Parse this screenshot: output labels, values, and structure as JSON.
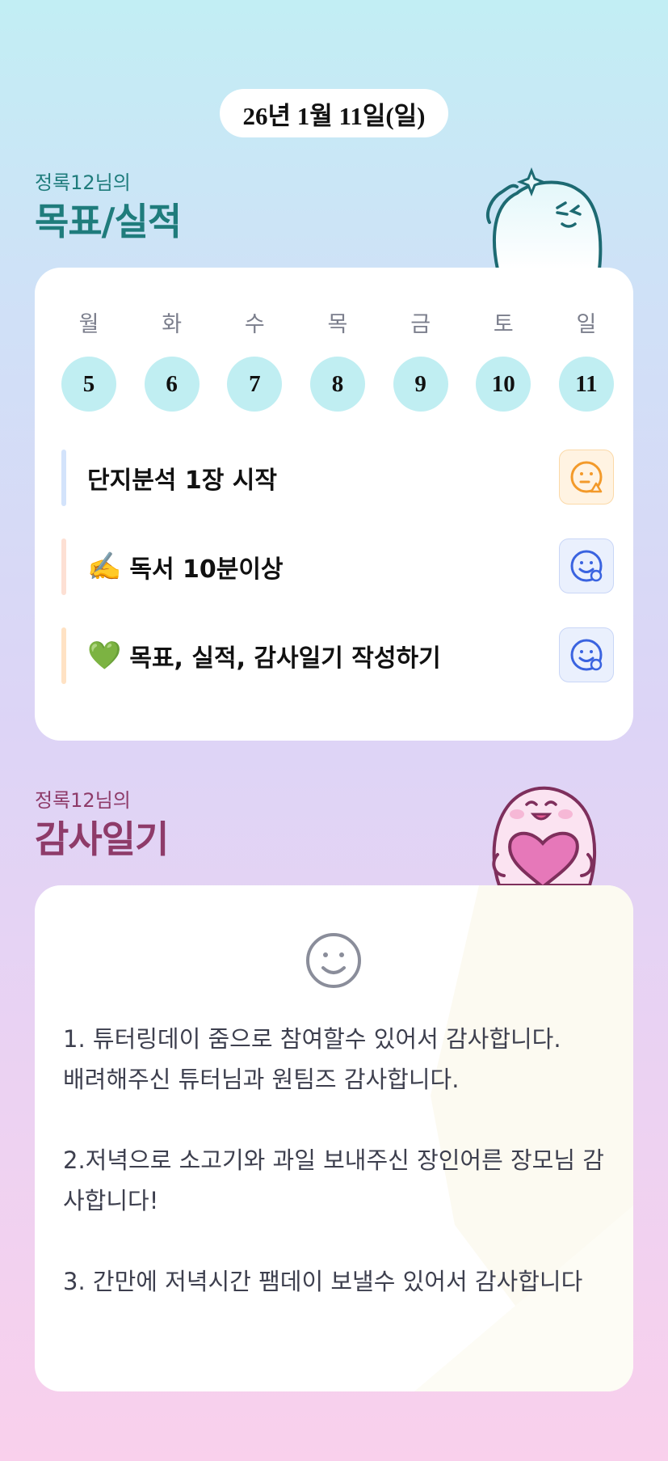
{
  "date": "26년 1월 11일(일)",
  "goals_section": {
    "subtitle": "정록12님의",
    "title": "목표/실적",
    "weekdays": [
      "월",
      "화",
      "수",
      "목",
      "금",
      "토",
      "일"
    ],
    "days": [
      "5",
      "6",
      "7",
      "8",
      "9",
      "10",
      "11"
    ],
    "goals": [
      {
        "emoji": "",
        "text": "단지분석 1장 시작",
        "bar_color": "#d3e3fb",
        "status_icon": "face-triangle-icon",
        "status_color": "#f39a2a",
        "status_bg": "#fff3e2"
      },
      {
        "emoji": "✍️",
        "text": "독서 10분이상",
        "bar_color": "#fde0d4",
        "status_icon": "face-circle-icon",
        "status_color": "#3a63e0",
        "status_bg": "#eaf0fd"
      },
      {
        "emoji": "💚",
        "text": "목표, 실적, 감사일기 작성하기",
        "bar_color": "#ffe2c4",
        "status_icon": "face-circle-icon",
        "status_color": "#3a63e0",
        "status_bg": "#eaf0fd"
      }
    ]
  },
  "diary_section": {
    "subtitle": "정록12님의",
    "title": "감사일기",
    "mood_icon": "smiley-face-icon",
    "text": "1. 튜터링데이 줌으로 참여할수 있어서 감사합니다.\n배려해주신 튜터님과 원팀즈 감사합니다.\n\n2.저녁으로 소고기와 과일 보내주신 장인어른 장모님 감사합니다!\n\n3. 간만에 저녁시간 팸데이 보낼수 있어서 감사합니다"
  }
}
